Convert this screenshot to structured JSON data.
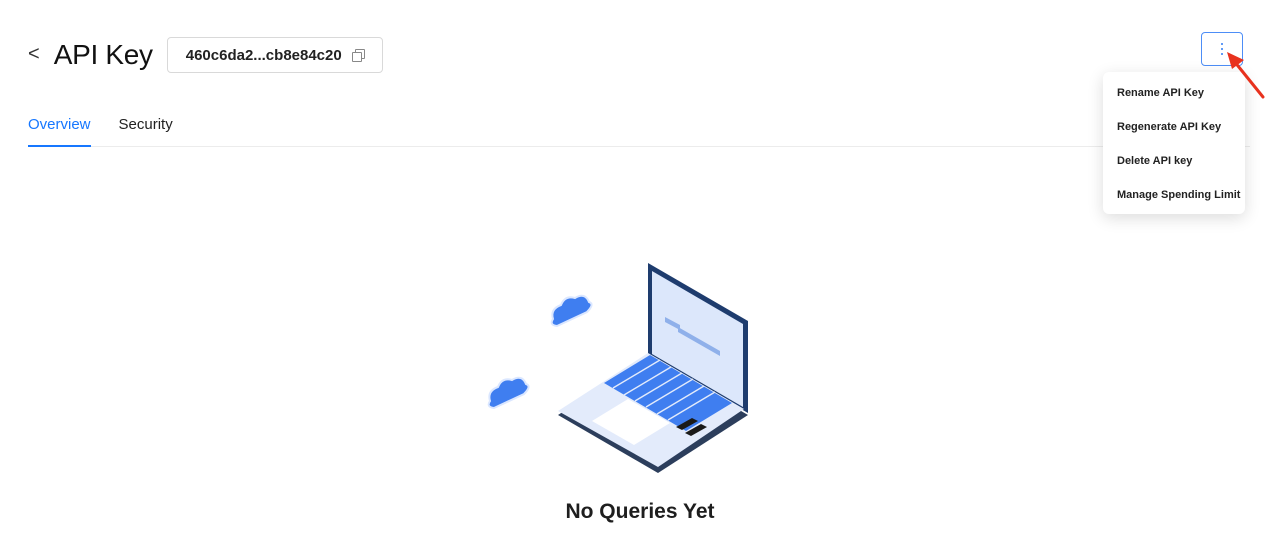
{
  "header": {
    "back_glyph": "<",
    "title": "API Key",
    "key_value": "460c6da2...cb8e84c20"
  },
  "tabs": [
    {
      "label": "Overview",
      "active": true
    },
    {
      "label": "Security",
      "active": false
    }
  ],
  "more_menu": {
    "items": [
      {
        "label": "Rename API Key"
      },
      {
        "label": "Regenerate API Key"
      },
      {
        "label": "Delete API key"
      },
      {
        "label": "Manage Spending Limit"
      }
    ]
  },
  "empty_state": {
    "title": "No Queries Yet"
  },
  "colors": {
    "accent": "#1677ff",
    "annotation_arrow": "#e8321e",
    "illustration_blue": "#3f7ef0"
  },
  "icons": [
    "chevron-left-icon",
    "copy-icon",
    "more-vertical-icon",
    "arrow-annotation"
  ]
}
